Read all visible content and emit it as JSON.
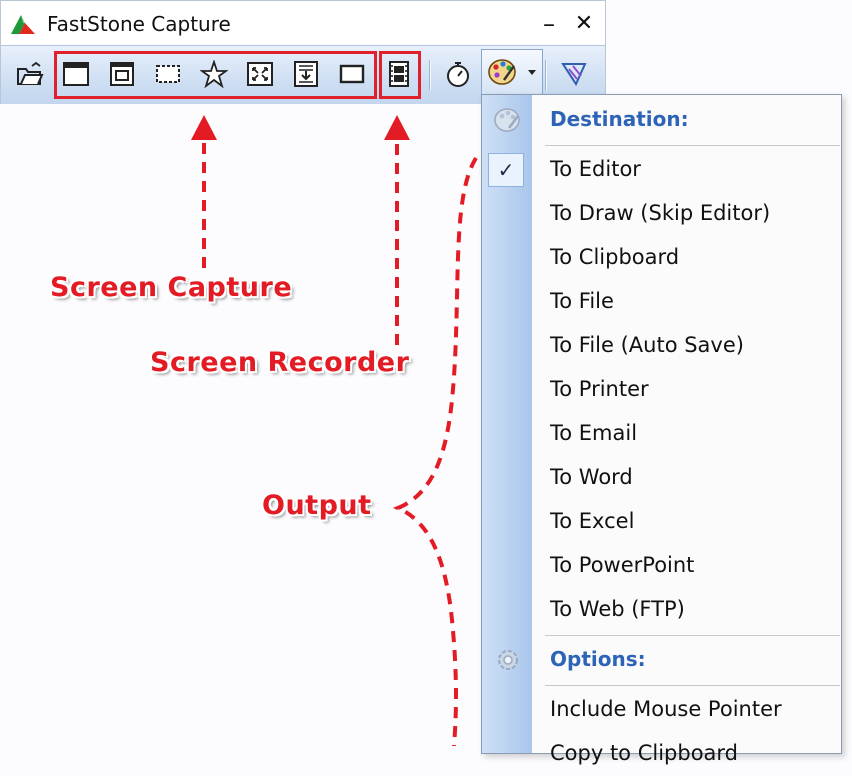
{
  "window": {
    "title": "FastStone Capture",
    "minimize_glyph": "–",
    "close_glyph": "✕"
  },
  "toolbar": {
    "buttons": [
      {
        "name": "open-folder-icon"
      },
      {
        "name": "capture-active-window-icon"
      },
      {
        "name": "capture-window-object-icon"
      },
      {
        "name": "capture-rectangle-icon"
      },
      {
        "name": "capture-freehand-icon"
      },
      {
        "name": "capture-full-screen-icon"
      },
      {
        "name": "capture-scrolling-window-icon"
      },
      {
        "name": "capture-fixed-region-icon"
      },
      {
        "name": "screen-recorder-icon"
      },
      {
        "name": "timer-icon"
      },
      {
        "name": "destination-palette-icon"
      },
      {
        "name": "settings-icon"
      }
    ]
  },
  "annotations": {
    "screen_capture": "Screen Capture",
    "screen_recorder": "Screen Recorder",
    "output": "Output",
    "color": "#e31b24"
  },
  "menu": {
    "destination_header": "Destination:",
    "items": [
      {
        "label": "To Editor",
        "checked": true
      },
      {
        "label": "To Draw (Skip Editor)"
      },
      {
        "label": "To Clipboard"
      },
      {
        "label": "To File"
      },
      {
        "label": "To File (Auto Save)"
      },
      {
        "label": "To Printer"
      },
      {
        "label": "To Email"
      },
      {
        "label": "To Word"
      },
      {
        "label": "To Excel"
      },
      {
        "label": "To PowerPoint"
      },
      {
        "label": "To Web (FTP)"
      }
    ],
    "options_header": "Options:",
    "options": [
      {
        "label": "Include Mouse Pointer"
      },
      {
        "label": "Copy to Clipboard"
      }
    ],
    "checkmark": "✓",
    "header_color": "#2d64b8"
  }
}
